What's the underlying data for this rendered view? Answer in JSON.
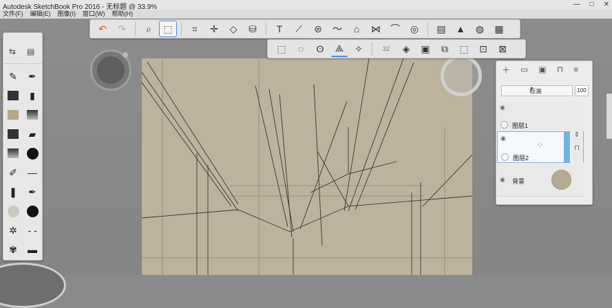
{
  "window": {
    "title": "Autodesk SketchBook Pro 2016 - 无标题 @ 33.9%",
    "buttons": [
      "—",
      "□",
      "✕"
    ]
  },
  "menu": [
    "文件(F)",
    "编辑(E)",
    "图像(I)",
    "窗口(W)",
    "帮助(H)"
  ],
  "toolbar": {
    "tools": [
      {
        "name": "undo-icon",
        "glyph": "↶"
      },
      {
        "name": "redo-icon",
        "glyph": "↷"
      },
      {
        "name": "zoom-icon",
        "glyph": "⌕"
      },
      {
        "name": "select-icon",
        "glyph": "⬚"
      },
      {
        "name": "crop-icon",
        "glyph": "⌗"
      },
      {
        "name": "transform-icon",
        "glyph": "✛"
      },
      {
        "name": "distort-icon",
        "glyph": "◇"
      },
      {
        "name": "fill-icon",
        "glyph": "⛁"
      },
      {
        "name": "text-icon",
        "glyph": "T"
      },
      {
        "name": "ruler-icon",
        "glyph": "⟋"
      },
      {
        "name": "ellipse-guide-icon",
        "glyph": "⊜"
      },
      {
        "name": "french-curve-icon",
        "glyph": "〜"
      },
      {
        "name": "perspective-icon",
        "glyph": "⌂"
      },
      {
        "name": "symmetry-icon",
        "glyph": "⋈"
      },
      {
        "name": "stroke-icon",
        "glyph": "⌒"
      },
      {
        "name": "shapes-icon",
        "glyph": "◎"
      },
      {
        "name": "copic-icon",
        "glyph": "▤"
      },
      {
        "name": "brush-library-icon",
        "glyph": "▲"
      },
      {
        "name": "color-wheel-icon",
        "glyph": "◍"
      },
      {
        "name": "palette-icon",
        "glyph": "▦"
      }
    ]
  },
  "selection_bar": {
    "tools": [
      {
        "name": "rect-select-icon",
        "glyph": "⬚"
      },
      {
        "name": "oval-select-icon",
        "glyph": "◌"
      },
      {
        "name": "lasso-select-icon",
        "glyph": "ʘ"
      },
      {
        "name": "poly-lasso-icon",
        "glyph": "⟁"
      },
      {
        "name": "magic-wand-icon",
        "glyph": "✧"
      }
    ],
    "size_value": "32",
    "extra": [
      {
        "name": "feather-icon",
        "glyph": "◈"
      },
      {
        "name": "select-all-icon",
        "glyph": "▣"
      },
      {
        "name": "invert-select-icon",
        "glyph": "⧉"
      },
      {
        "name": "deselect-icon",
        "glyph": "⬚"
      },
      {
        "name": "crop-select-icon",
        "glyph": "⊡"
      },
      {
        "name": "clear-select-icon",
        "glyph": "⊠"
      }
    ]
  },
  "layers": {
    "blend_mode": "标准",
    "opacity": "100",
    "items": [
      {
        "name": "图层1"
      },
      {
        "name": "图层2"
      },
      {
        "name": "背景"
      }
    ]
  },
  "colors": {
    "canvas": "#bdb29e",
    "accent": "#3b8fe0",
    "workspace": "#8a8a8a"
  }
}
